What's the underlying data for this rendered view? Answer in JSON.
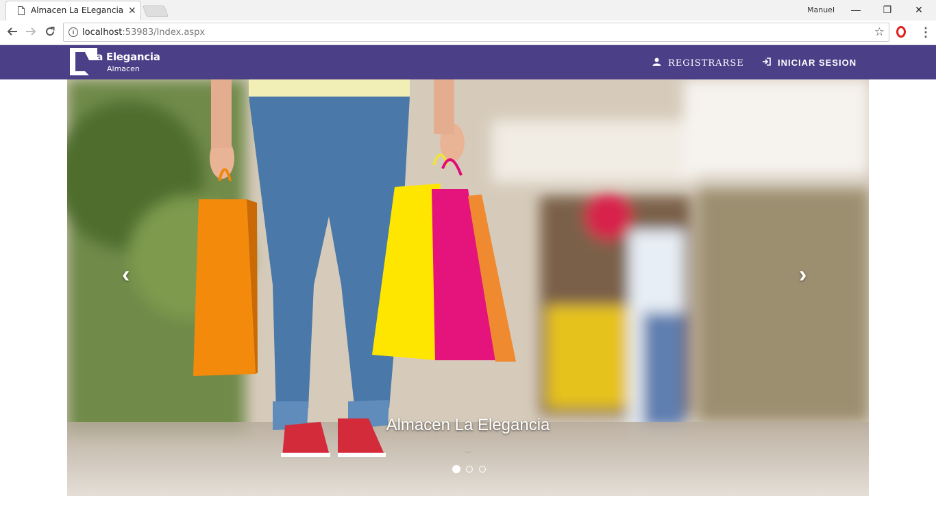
{
  "browser": {
    "tab_title": "Almacen La ELegancia",
    "tab_close": "✕",
    "profile_name": "Manuel",
    "url_host": "localhost",
    "url_path": ":53983/Index.aspx",
    "icons": [
      "page-icon",
      "back-icon",
      "forward-icon",
      "reload-icon",
      "info-icon",
      "star-icon",
      "opera-icon",
      "menu-icon"
    ]
  },
  "window": {
    "minimize": "—",
    "maximize": "❐",
    "close": "✕"
  },
  "site": {
    "brand_title": "La Elegancia",
    "brand_subtitle": "Almacen",
    "nav_register": "REGISTRARSE",
    "nav_login": "INICIAR SESION",
    "nav_color": "#4b3f87"
  },
  "carousel": {
    "caption": "Almacen La Elegancia",
    "subcaption": "...",
    "prev_glyph": "‹",
    "next_glyph": "›",
    "slide_count": 3,
    "active_slide": 1
  }
}
